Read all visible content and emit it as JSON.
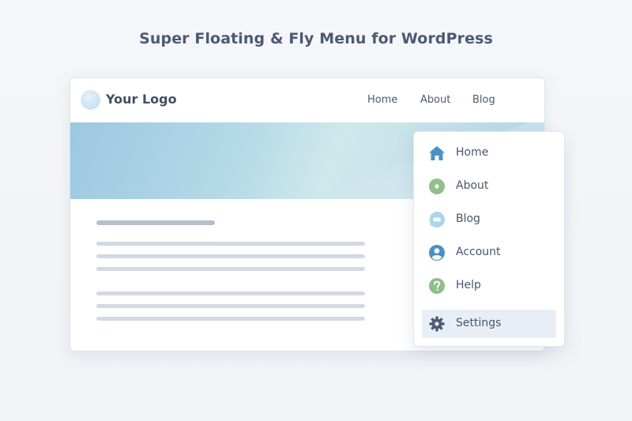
{
  "page": {
    "title": "Super Floating & Fly Menu for WordPress"
  },
  "site": {
    "logo_text": "Your Logo",
    "nav": [
      {
        "label": "Home"
      },
      {
        "label": "About"
      },
      {
        "label": "Blog"
      }
    ]
  },
  "fly_menu": {
    "items": [
      {
        "label": "Home",
        "icon": "home-icon",
        "color": "#4a90c2"
      },
      {
        "label": "About",
        "icon": "info-icon",
        "color": "#8fbf8a"
      },
      {
        "label": "Blog",
        "icon": "chat-bubble-icon",
        "color": "#a9d6ea"
      },
      {
        "label": "Account",
        "icon": "user-icon",
        "color": "#4a90c2"
      },
      {
        "label": "Help",
        "icon": "help-icon",
        "color": "#8fbf8a"
      },
      {
        "label": "Settings",
        "icon": "gear-icon",
        "color": "#4b5a72",
        "active": true
      }
    ]
  },
  "colors": {
    "accent_blue": "#4a90c2",
    "accent_green": "#8fbf8a",
    "text": "#46566e",
    "active_bg": "#e8eef6"
  }
}
